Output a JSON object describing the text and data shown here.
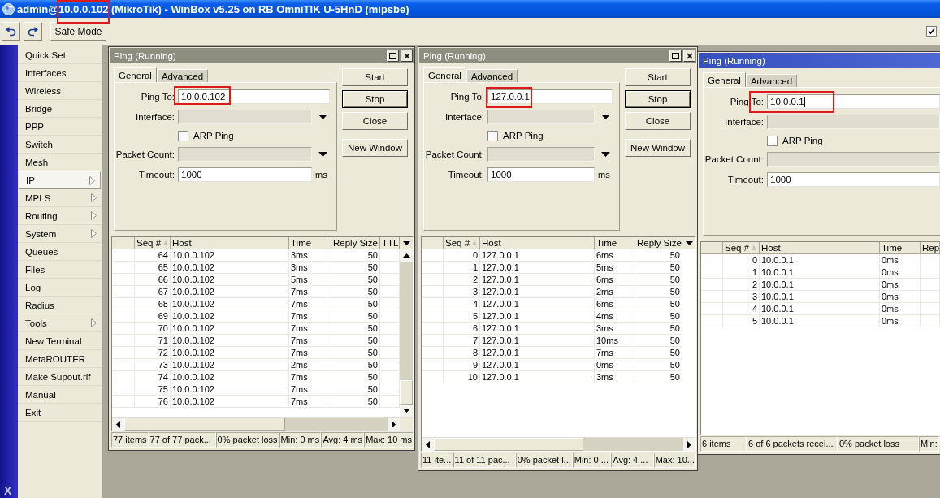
{
  "window": {
    "title_parts": [
      {
        "text": "admin@",
        "highlighted": false
      },
      {
        "text": "10.0.0.102",
        "highlighted": true
      },
      {
        "text": " (MikroTik) - WinBox v5.25 on RB OmniTIK U-5HnD (mipsbe)",
        "highlighted": false
      }
    ]
  },
  "toolbar": {
    "safe_mode_button": "Safe Mode",
    "checkbox": {
      "checked": true
    }
  },
  "sidebar": {
    "strip_text": "X",
    "items": [
      {
        "label": "Quick Set",
        "selected": false,
        "submenu": false
      },
      {
        "label": "Interfaces",
        "selected": false,
        "submenu": false
      },
      {
        "label": "Wireless",
        "selected": false,
        "submenu": false
      },
      {
        "label": "Bridge",
        "selected": false,
        "submenu": false
      },
      {
        "label": "PPP",
        "selected": false,
        "submenu": false
      },
      {
        "label": "Switch",
        "selected": false,
        "submenu": false
      },
      {
        "label": "Mesh",
        "selected": false,
        "submenu": false
      },
      {
        "label": "IP",
        "selected": true,
        "submenu": true
      },
      {
        "label": "MPLS",
        "selected": false,
        "submenu": true
      },
      {
        "label": "Routing",
        "selected": false,
        "submenu": true
      },
      {
        "label": "System",
        "selected": false,
        "submenu": true
      },
      {
        "label": "Queues",
        "selected": false,
        "submenu": false
      },
      {
        "label": "Files",
        "selected": false,
        "submenu": false
      },
      {
        "label": "Log",
        "selected": false,
        "submenu": false
      },
      {
        "label": "Radius",
        "selected": false,
        "submenu": false
      },
      {
        "label": "Tools",
        "selected": false,
        "submenu": true
      },
      {
        "label": "New Terminal",
        "selected": false,
        "submenu": false
      },
      {
        "label": "MetaROUTER",
        "selected": false,
        "submenu": false
      },
      {
        "label": "Make Supout.rif",
        "selected": false,
        "submenu": false
      },
      {
        "label": "Manual",
        "selected": false,
        "submenu": false
      },
      {
        "label": "Exit",
        "selected": false,
        "submenu": false
      }
    ]
  },
  "ping_windows": [
    {
      "title": "Ping (Running)",
      "active": false,
      "tabs": [
        {
          "label": "General",
          "selected": true
        },
        {
          "label": "Advanced",
          "selected": false
        }
      ],
      "fields": [
        {
          "kind": "text",
          "label": "Ping To:",
          "value": "10.0.0.102",
          "highlighted": true,
          "focused": false
        },
        {
          "kind": "dropdown",
          "label": "Interface:",
          "disabled": true
        },
        {
          "kind": "checkbox",
          "label": "ARP Ping",
          "checked": false
        },
        {
          "kind": "dropdown",
          "label": "Packet Count:",
          "disabled": true
        },
        {
          "kind": "text",
          "label": "Timeout:",
          "value": "1000",
          "unit": "ms",
          "highlighted": false,
          "focused": false
        }
      ],
      "buttons": [
        {
          "label": "Start",
          "default": false
        },
        {
          "label": "Stop",
          "default": true
        },
        {
          "label": "Close",
          "default": false
        },
        {
          "label": "New Window",
          "default": false
        }
      ],
      "table": {
        "columns": [
          {
            "label": "Seq #",
            "sorted": true
          },
          {
            "label": "Host",
            "sorted": false
          },
          {
            "label": "Time",
            "sorted": false
          },
          {
            "label": "Reply Size",
            "sorted": false
          },
          {
            "label": "TTL",
            "sorted": false
          }
        ],
        "rows": [
          [
            "64",
            "10.0.0.102",
            "3ms",
            "50"
          ],
          [
            "65",
            "10.0.0.102",
            "3ms",
            "50"
          ],
          [
            "66",
            "10.0.0.102",
            "5ms",
            "50"
          ],
          [
            "67",
            "10.0.0.102",
            "7ms",
            "50"
          ],
          [
            "68",
            "10.0.0.102",
            "7ms",
            "50"
          ],
          [
            "69",
            "10.0.0.102",
            "7ms",
            "50"
          ],
          [
            "70",
            "10.0.0.102",
            "7ms",
            "50"
          ],
          [
            "71",
            "10.0.0.102",
            "7ms",
            "50"
          ],
          [
            "72",
            "10.0.0.102",
            "7ms",
            "50"
          ],
          [
            "73",
            "10.0.0.102",
            "2ms",
            "50"
          ],
          [
            "74",
            "10.0.0.102",
            "7ms",
            "50"
          ],
          [
            "75",
            "10.0.0.102",
            "7ms",
            "50"
          ],
          [
            "76",
            "10.0.0.102",
            "7ms",
            "50"
          ]
        ]
      },
      "status_bar": [
        "77 items",
        "77 of 77 pack...",
        "0% packet loss",
        "Min: 0 ms",
        "Avg: 4 ms",
        "Max: 10 ms"
      ]
    },
    {
      "title": "Ping (Running)",
      "active": false,
      "tabs": [
        {
          "label": "General",
          "selected": true
        },
        {
          "label": "Advanced",
          "selected": false
        }
      ],
      "fields": [
        {
          "kind": "text",
          "label": "Ping To:",
          "value": "127.0.0.1",
          "highlighted": true,
          "focused": false
        },
        {
          "kind": "dropdown",
          "label": "Interface:",
          "disabled": true
        },
        {
          "kind": "checkbox",
          "label": "ARP Ping",
          "checked": false
        },
        {
          "kind": "dropdown",
          "label": "Packet Count:",
          "disabled": true
        },
        {
          "kind": "text",
          "label": "Timeout:",
          "value": "1000",
          "unit": "ms",
          "highlighted": false,
          "focused": false
        }
      ],
      "buttons": [
        {
          "label": "Start",
          "default": false
        },
        {
          "label": "Stop",
          "default": true
        },
        {
          "label": "Close",
          "default": false
        },
        {
          "label": "New Window",
          "default": false
        }
      ],
      "table": {
        "columns": [
          {
            "label": "Seq #",
            "sorted": true
          },
          {
            "label": "Host",
            "sorted": false
          },
          {
            "label": "Time",
            "sorted": false
          },
          {
            "label": "Reply Size",
            "sorted": false
          }
        ],
        "rows": [
          [
            "0",
            "127.0.0.1",
            "6ms",
            "50"
          ],
          [
            "1",
            "127.0.0.1",
            "5ms",
            "50"
          ],
          [
            "2",
            "127.0.0.1",
            "6ms",
            "50"
          ],
          [
            "3",
            "127.0.0.1",
            "2ms",
            "50"
          ],
          [
            "4",
            "127.0.0.1",
            "6ms",
            "50"
          ],
          [
            "5",
            "127.0.0.1",
            "4ms",
            "50"
          ],
          [
            "6",
            "127.0.0.1",
            "3ms",
            "50"
          ],
          [
            "7",
            "127.0.0.1",
            "10ms",
            "50"
          ],
          [
            "8",
            "127.0.0.1",
            "7ms",
            "50"
          ],
          [
            "9",
            "127.0.0.1",
            "0ms",
            "50"
          ],
          [
            "10",
            "127.0.0.1",
            "3ms",
            "50"
          ]
        ]
      },
      "status_bar": [
        "11 ite...",
        "11 of 11 pac...",
        "0% packet l...",
        "Min: 0 ...",
        "Avg: 4 ...",
        "Max: 10..."
      ]
    },
    {
      "title": "Ping (Running)",
      "active": true,
      "tabs": [
        {
          "label": "General",
          "selected": true
        },
        {
          "label": "Advanced",
          "selected": false
        }
      ],
      "fields": [
        {
          "kind": "text",
          "label": "Ping To:",
          "value": "10.0.0.1",
          "highlighted": true,
          "focused": true
        },
        {
          "kind": "dropdown",
          "label": "Interface:",
          "disabled": true
        },
        {
          "kind": "checkbox",
          "label": "ARP Ping",
          "checked": false
        },
        {
          "kind": "dropdown",
          "label": "Packet Count:",
          "disabled": true
        },
        {
          "kind": "text",
          "label": "Timeout:",
          "value": "1000",
          "highlighted": false,
          "focused": false
        }
      ],
      "table": {
        "columns": [
          {
            "label": "Seq #",
            "sorted": true
          },
          {
            "label": "Host",
            "sorted": false
          },
          {
            "label": "Time",
            "sorted": false
          },
          {
            "label": "Rep",
            "sorted": false
          }
        ],
        "rows": [
          [
            "0",
            "10.0.0.1",
            "0ms"
          ],
          [
            "1",
            "10.0.0.1",
            "0ms"
          ],
          [
            "2",
            "10.0.0.1",
            "0ms"
          ],
          [
            "3",
            "10.0.0.1",
            "0ms"
          ],
          [
            "4",
            "10.0.0.1",
            "0ms"
          ],
          [
            "5",
            "10.0.0.1",
            "0ms"
          ]
        ]
      },
      "status_bar": [
        "6 items",
        "6 of 6 packets recei...",
        "0% packet loss",
        "Min:"
      ]
    }
  ]
}
